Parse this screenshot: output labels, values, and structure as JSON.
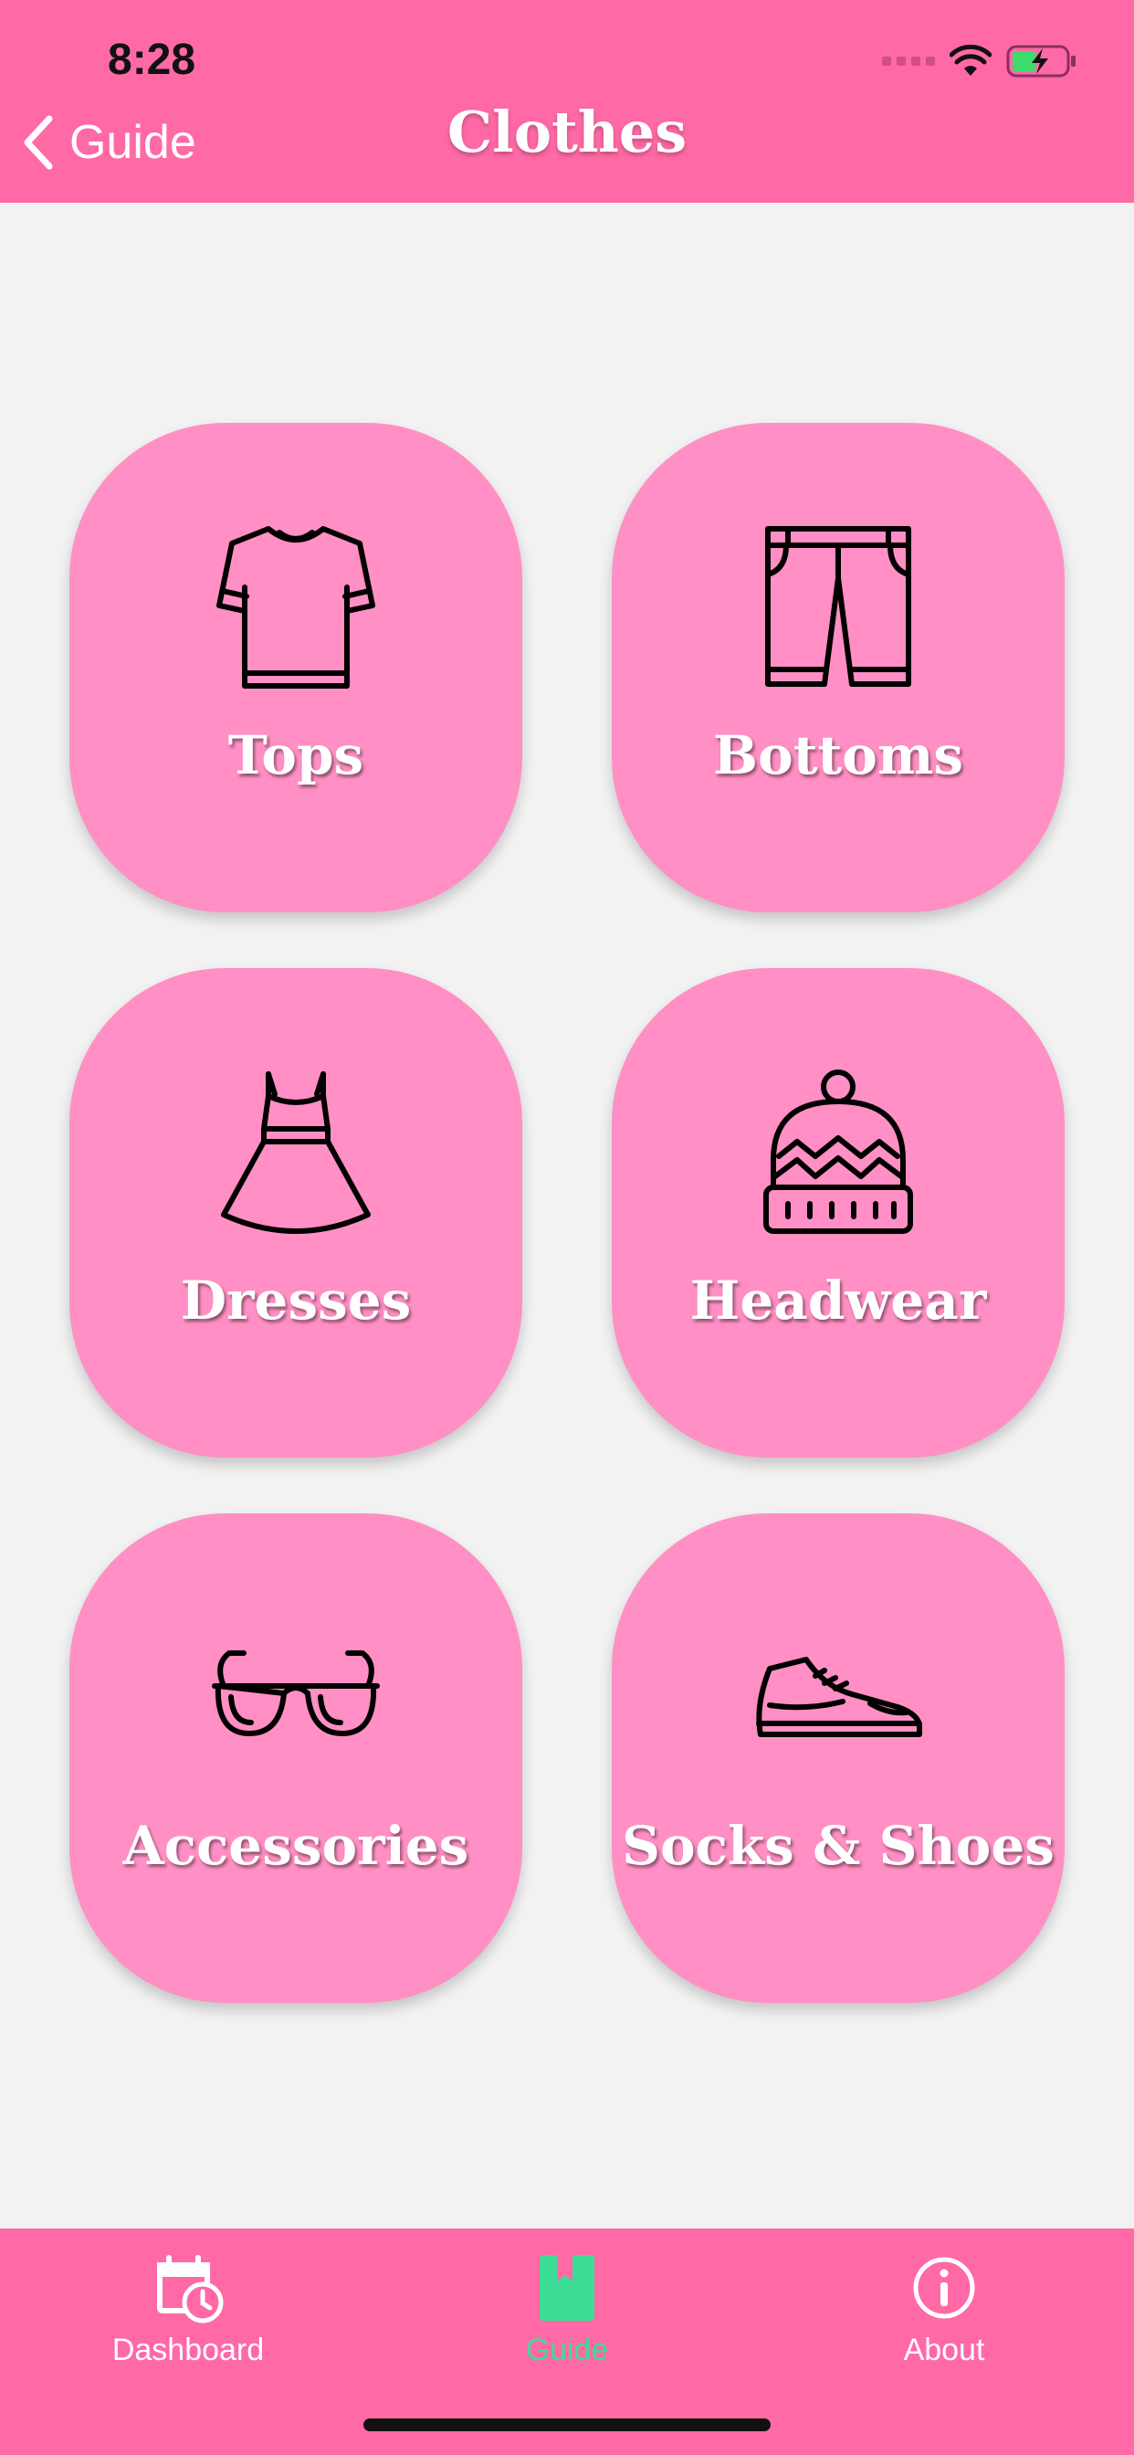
{
  "status_bar": {
    "time": "8:28"
  },
  "header": {
    "back_label": "Guide",
    "title": "Clothes"
  },
  "categories": [
    {
      "label": "Tops",
      "icon": "t-shirt-icon"
    },
    {
      "label": "Bottoms",
      "icon": "shorts-icon"
    },
    {
      "label": "Dresses",
      "icon": "dress-icon"
    },
    {
      "label": "Headwear",
      "icon": "beanie-icon"
    },
    {
      "label": "Accessories",
      "icon": "sunglasses-icon"
    },
    {
      "label": "Socks & Shoes",
      "icon": "sneaker-icon"
    }
  ],
  "tabs": [
    {
      "label": "Dashboard",
      "icon": "calendar-clock-icon",
      "active": false
    },
    {
      "label": "Guide",
      "icon": "book-icon",
      "active": true
    },
    {
      "label": "About",
      "icon": "info-icon",
      "active": false
    }
  ],
  "colors": {
    "header": "#ff69a5",
    "tile": "#ff8fc4",
    "background": "#f2f2f2",
    "active_tab": "#3ddc97"
  }
}
